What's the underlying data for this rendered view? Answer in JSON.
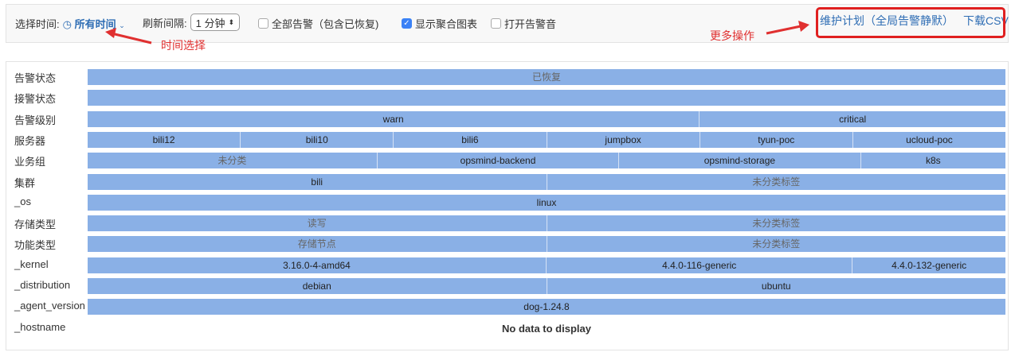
{
  "toolbar": {
    "time_label": "选择时间:",
    "time_value": "所有时间",
    "refresh_label": "刷新间隔:",
    "refresh_value": "1 分钟",
    "all_alerts_label": "全部告警（包含已恢复)",
    "all_alerts_checked": false,
    "show_chart_label": "显示聚合图表",
    "show_chart_checked": true,
    "sound_label": "打开告警音",
    "sound_checked": false,
    "maintenance_link": "维护计划（全局告警静默）",
    "csv_link": "下载CSV"
  },
  "annotations": {
    "time_select": "时间选择",
    "more_actions": "更多操作"
  },
  "bar_color": "#8ab0e6",
  "rows": [
    {
      "label": "告警状态",
      "segments": [
        {
          "text": "已恢复",
          "weight": 1,
          "muted": true
        }
      ]
    },
    {
      "label": "接警状态",
      "segments": [
        {
          "text": "",
          "weight": 1
        }
      ]
    },
    {
      "label": "告警级别",
      "segments": [
        {
          "text": "warn",
          "weight": 2
        },
        {
          "text": "critical",
          "weight": 1
        }
      ]
    },
    {
      "label": "服务器",
      "segments": [
        {
          "text": "bili12",
          "weight": 1
        },
        {
          "text": "bili10",
          "weight": 1
        },
        {
          "text": "bili6",
          "weight": 1
        },
        {
          "text": "jumpbox",
          "weight": 1
        },
        {
          "text": "tyun-poc",
          "weight": 1
        },
        {
          "text": "ucloud-poc",
          "weight": 1
        }
      ]
    },
    {
      "label": "业务组",
      "segments": [
        {
          "text": "未分类",
          "weight": 6,
          "muted": true
        },
        {
          "text": "opsmind-backend",
          "weight": 5
        },
        {
          "text": "opsmind-storage",
          "weight": 5
        },
        {
          "text": "k8s",
          "weight": 3
        }
      ]
    },
    {
      "label": "集群",
      "segments": [
        {
          "text": "bili",
          "weight": 1
        },
        {
          "text": "未分类标签",
          "weight": 1,
          "muted": true
        }
      ]
    },
    {
      "label": "_os",
      "segments": [
        {
          "text": "linux",
          "weight": 1
        }
      ]
    },
    {
      "label": "存储类型",
      "segments": [
        {
          "text": "读写",
          "weight": 1,
          "muted": true
        },
        {
          "text": "未分类标签",
          "weight": 1,
          "muted": true
        }
      ]
    },
    {
      "label": "功能类型",
      "segments": [
        {
          "text": "存储节点",
          "weight": 1,
          "muted": true
        },
        {
          "text": "未分类标签",
          "weight": 1,
          "muted": true
        }
      ]
    },
    {
      "label": "_kernel",
      "segments": [
        {
          "text": "3.16.0-4-amd64",
          "weight": 3
        },
        {
          "text": "4.4.0-116-generic",
          "weight": 2
        },
        {
          "text": "4.4.0-132-generic",
          "weight": 1
        }
      ]
    },
    {
      "label": "_distribution",
      "segments": [
        {
          "text": "debian",
          "weight": 1
        },
        {
          "text": "ubuntu",
          "weight": 1
        }
      ]
    },
    {
      "label": "_agent_version",
      "segments": [
        {
          "text": "dog-1.24.8",
          "weight": 1
        }
      ]
    },
    {
      "label": "_hostname",
      "segments": [],
      "empty_text": "No data to display"
    }
  ]
}
